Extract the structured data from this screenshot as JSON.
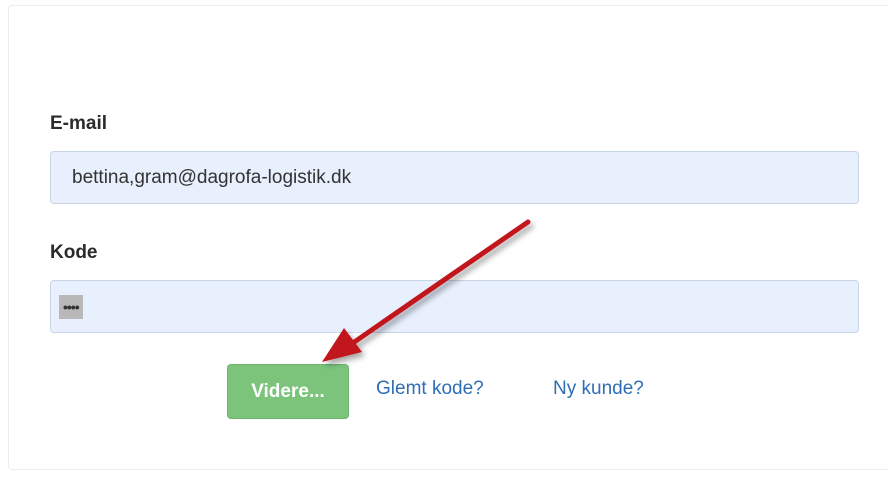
{
  "form": {
    "email_label": "E-mail",
    "email_value": "bettina,gram@dagrofa-logistik.dk",
    "password_label": "Kode",
    "password_masked": "••••",
    "continue_label": "Videre...",
    "forgot_label": "Glemt kode?",
    "new_customer_label": "Ny kunde?"
  },
  "annotation": {
    "arrow_color": "#c0161c",
    "icon": "red-arrow-icon"
  },
  "colors": {
    "continue_button": "#7cc47c",
    "link": "#2f6db5",
    "input_background": "#e8f0fe"
  }
}
